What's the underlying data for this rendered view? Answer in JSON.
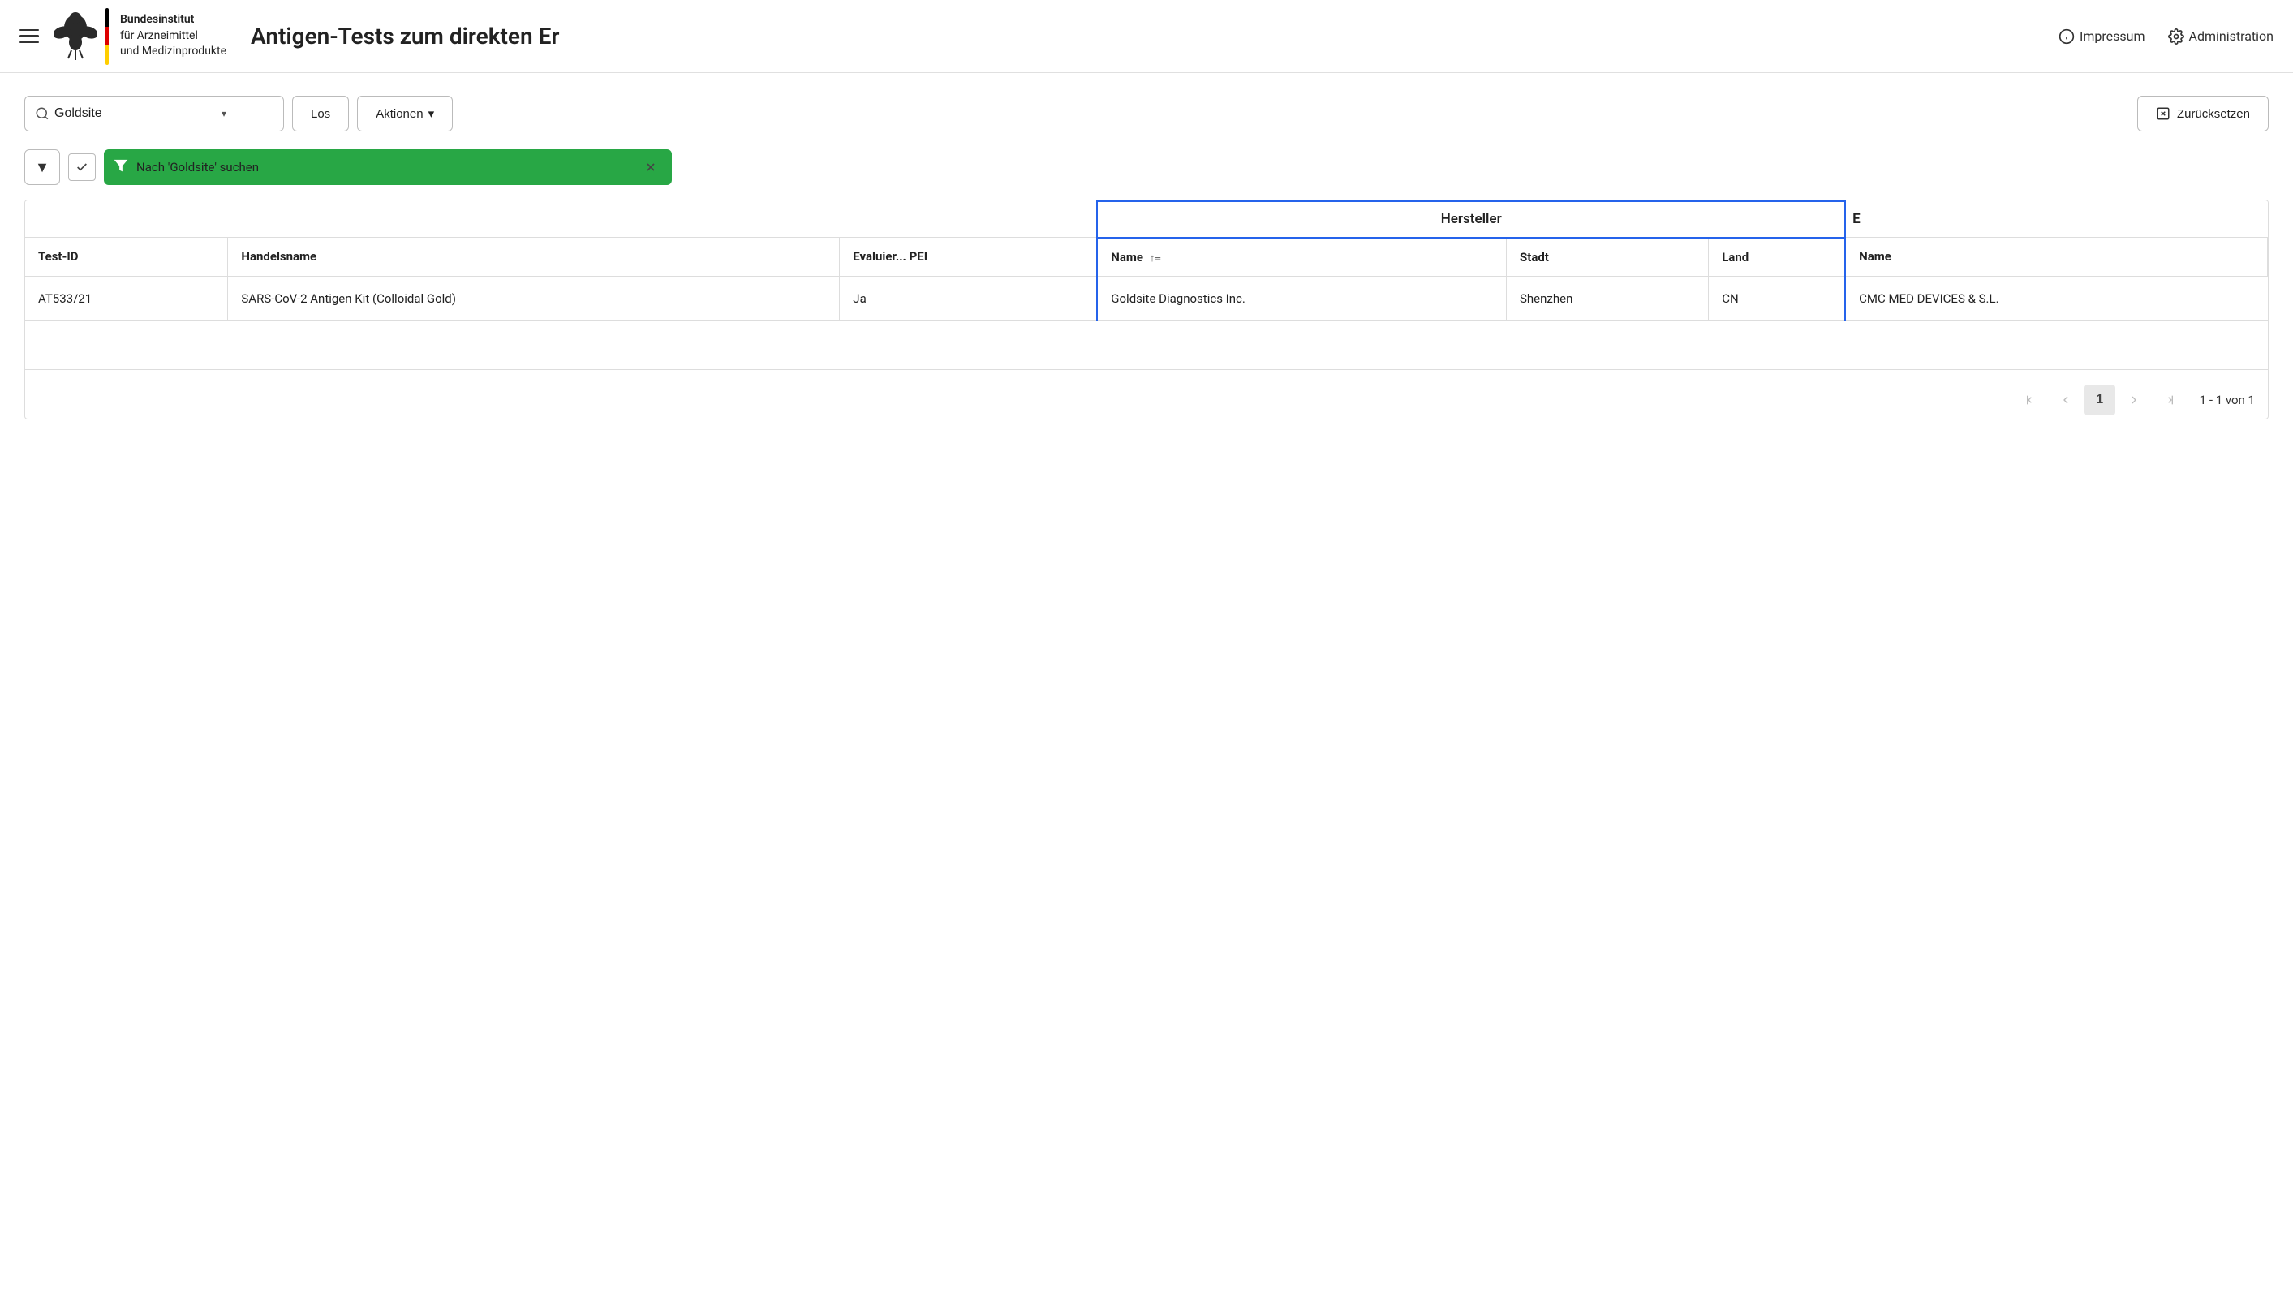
{
  "header": {
    "logo": {
      "line1": "Bundesinstitut",
      "line2": "für Arzneimittel",
      "line3": "und Medizinprodukte"
    },
    "title": "Antigen-Tests zum direkten Er",
    "nav": {
      "impressum": "Impressum",
      "administration": "Administration"
    },
    "hamburger_label": "Menu"
  },
  "search": {
    "value": "Goldsite",
    "los_label": "Los",
    "aktionen_label": "Aktionen",
    "zuruck_label": "Zurücksetzen"
  },
  "filter": {
    "chip_text": "Nach 'Goldsite' suchen"
  },
  "table": {
    "group_header": "Hersteller",
    "group_header_right": "E",
    "columns": [
      {
        "key": "test_id",
        "label": "Test-ID"
      },
      {
        "key": "handelsname",
        "label": "Handelsname"
      },
      {
        "key": "evaluier_pei",
        "label": "Evaluier... PEI"
      },
      {
        "key": "hersteller_name",
        "label": "Name",
        "sortable": true
      },
      {
        "key": "hersteller_stadt",
        "label": "Stadt"
      },
      {
        "key": "hersteller_land",
        "label": "Land"
      },
      {
        "key": "name2",
        "label": "Name"
      }
    ],
    "rows": [
      {
        "test_id": "AT533/21",
        "handelsname": "SARS-CoV-2 Antigen Kit (Colloidal Gold)",
        "evaluier_pei": "Ja",
        "hersteller_name": "Goldsite Diagnostics Inc.",
        "hersteller_stadt": "Shenzhen",
        "hersteller_land": "CN",
        "name2": "CMC MED DEVICES & S.L."
      }
    ]
  },
  "pagination": {
    "current_page": 1,
    "total_pages": 1,
    "page_info": "1 - 1 von 1"
  }
}
